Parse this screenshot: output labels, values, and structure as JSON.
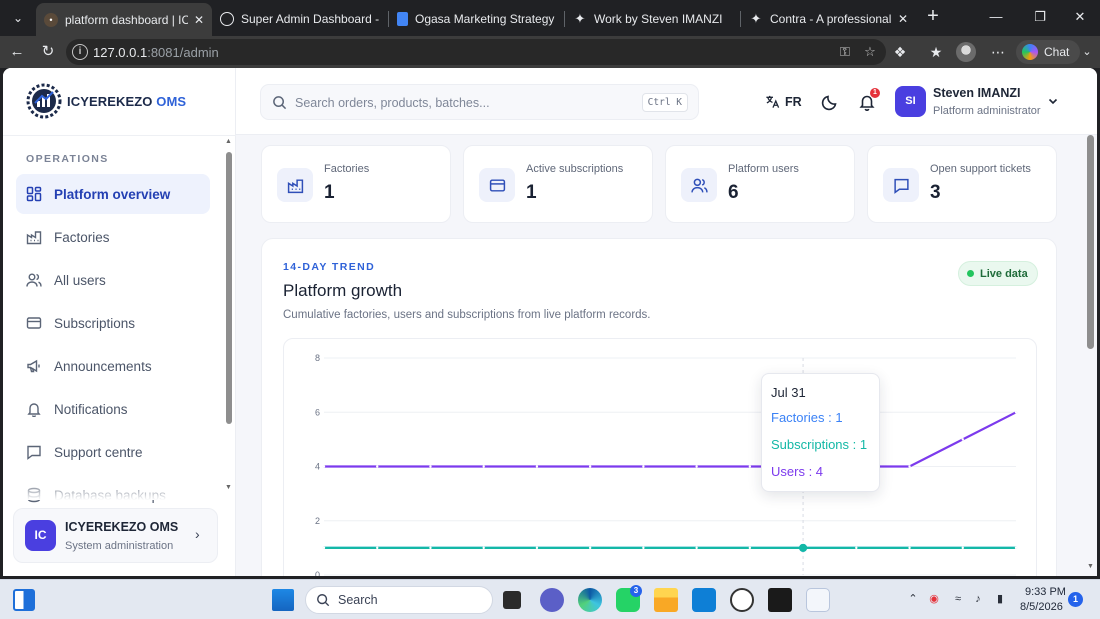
{
  "browser": {
    "tabs": [
      {
        "label": "platform dashboard | ICYEREKEZO OMS",
        "active": true
      },
      {
        "label": "Super Admin Dashboard - Linear"
      },
      {
        "label": "Ogasa Marketing Strategy Plan"
      },
      {
        "label": "Work by Steven IMANZI"
      },
      {
        "label": "Contra - A professional network"
      }
    ],
    "url_host": "127.0.0.1",
    "url_path": ":8081/admin",
    "chat_label": "Chat"
  },
  "sidebar": {
    "brand": "ICYEREKEZO",
    "brand_accent": "OMS",
    "section": "OPERATIONS",
    "items": [
      {
        "label": "Platform overview",
        "icon": "dashboard-icon"
      },
      {
        "label": "Factories",
        "icon": "factory-icon"
      },
      {
        "label": "All users",
        "icon": "users-icon"
      },
      {
        "label": "Subscriptions",
        "icon": "card-icon"
      },
      {
        "label": "Announcements",
        "icon": "megaphone-icon"
      },
      {
        "label": "Notifications",
        "icon": "bell-icon"
      },
      {
        "label": "Support centre",
        "icon": "chat-icon"
      },
      {
        "label": "Database backups",
        "icon": "database-icon"
      }
    ],
    "org": {
      "initials": "IC",
      "name": "ICYEREKEZO OMS",
      "subtitle": "System administration"
    }
  },
  "header": {
    "search_placeholder": "Search orders, products, batches...",
    "shortcut": "Ctrl K",
    "language": "FR",
    "notification_count": "1",
    "user": {
      "initials": "SI",
      "name": "Steven IMANZI",
      "role": "Platform administrator"
    }
  },
  "stats": [
    {
      "label": "Factories",
      "value": "1",
      "icon": "factory-icon"
    },
    {
      "label": "Active subscriptions",
      "value": "1",
      "icon": "card-icon"
    },
    {
      "label": "Platform users",
      "value": "6",
      "icon": "users-icon"
    },
    {
      "label": "Open support tickets",
      "value": "3",
      "icon": "chat-icon"
    }
  ],
  "trend": {
    "eyebrow": "14-DAY TREND",
    "title": "Platform growth",
    "subtitle": "Cumulative factories, users and subscriptions from live platform records.",
    "live_label": "Live data",
    "tooltip": {
      "date": "Jul 31",
      "rows": [
        {
          "label": "Factories",
          "value": "1"
        },
        {
          "label": "Subscriptions",
          "value": "1"
        },
        {
          "label": "Users",
          "value": "4"
        }
      ]
    }
  },
  "chart_data": {
    "type": "line",
    "points_count": 14,
    "highlight_index": 9,
    "y_ticks": [
      0,
      2,
      4,
      6,
      8
    ],
    "ylim": [
      0,
      8
    ],
    "grid": true,
    "series": [
      {
        "name": "Users",
        "color": "#7c3aed",
        "values": [
          4,
          4,
          4,
          4,
          4,
          4,
          4,
          4,
          4,
          4,
          4,
          4,
          5,
          6
        ]
      },
      {
        "name": "Subscriptions",
        "color": "#14b8a6",
        "values": [
          1,
          1,
          1,
          1,
          1,
          1,
          1,
          1,
          1,
          1,
          1,
          1,
          1,
          1
        ]
      },
      {
        "name": "Factories",
        "color": "#0ea5e9",
        "values": [
          1,
          1,
          1,
          1,
          1,
          1,
          1,
          1,
          1,
          1,
          1,
          1,
          1,
          1
        ]
      }
    ]
  },
  "taskbar": {
    "search_label": "Search",
    "whatsapp_badge": "3",
    "time": "9:33 PM",
    "date": "8/5/2026",
    "notifications": "1"
  },
  "colors": {
    "accent": "#2f62d8",
    "avatar": "#4a3fe0",
    "users": "#7c3aed",
    "subscriptions": "#14b8a6"
  }
}
